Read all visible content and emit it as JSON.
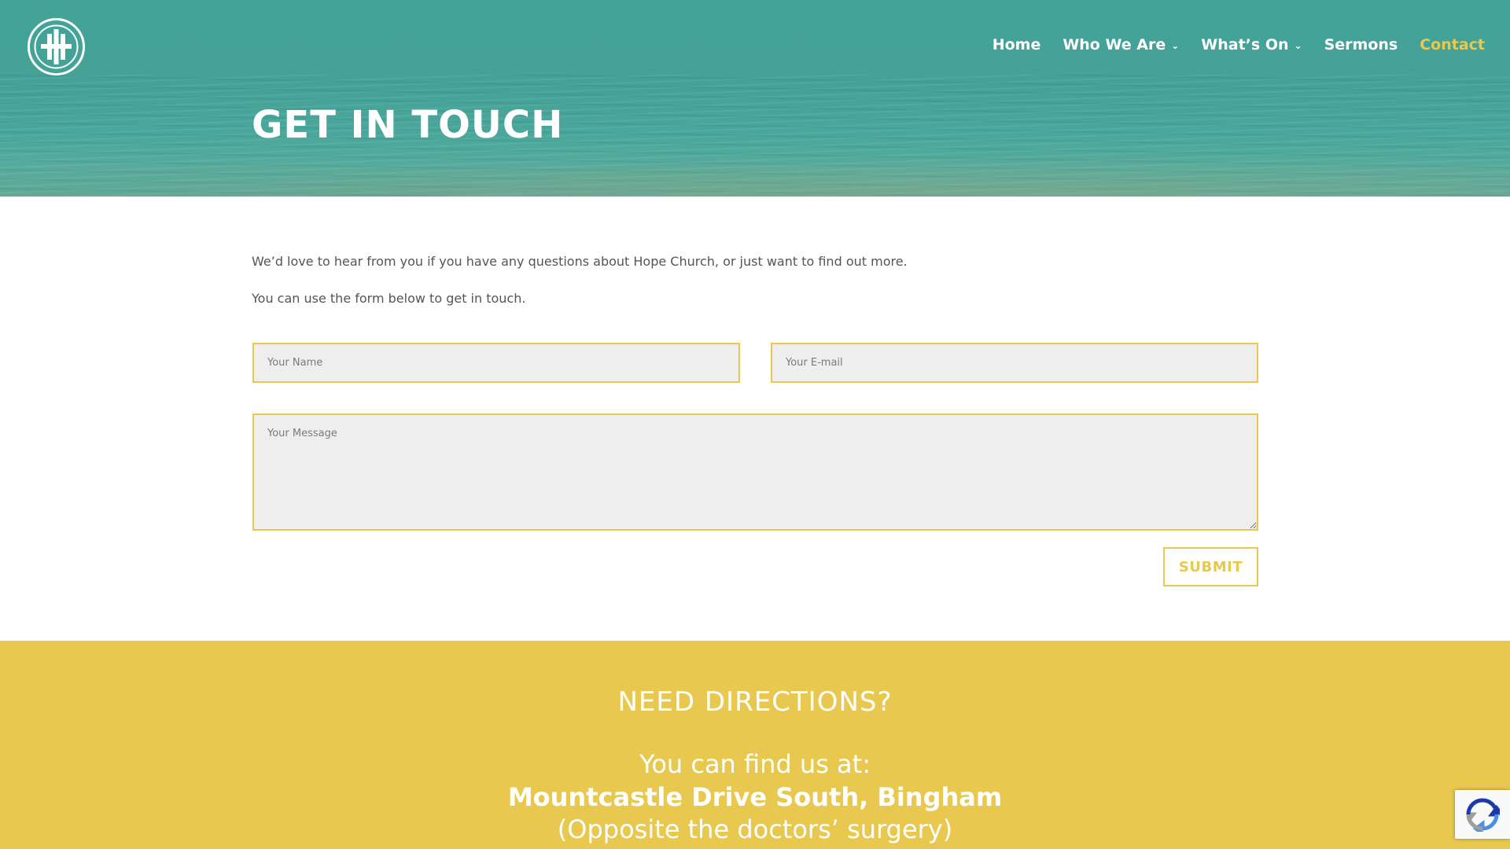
{
  "nav": {
    "items": [
      {
        "label": "Home",
        "has_dropdown": false,
        "active": false
      },
      {
        "label": "Who We Are",
        "has_dropdown": true,
        "active": false
      },
      {
        "label": "What’s On",
        "has_dropdown": true,
        "active": false
      },
      {
        "label": "Sermons",
        "has_dropdown": false,
        "active": false
      },
      {
        "label": "Contact",
        "has_dropdown": false,
        "active": true
      }
    ],
    "dropdown_icon": "chevron-down-icon"
  },
  "hero": {
    "title": "GET IN TOUCH"
  },
  "intro": {
    "line1": "We’d love to hear from you if you have any questions about Hope Church, or just want to find out more.",
    "line2": "You can use the form below to get in touch."
  },
  "form": {
    "name_placeholder": "Your Name",
    "name_value": "",
    "email_placeholder": "Your E-mail",
    "email_value": "",
    "message_placeholder": "Your Message",
    "message_value": "",
    "submit_label": "SUBMIT"
  },
  "directions": {
    "title": "NEED DIRECTIONS?",
    "line1": "You can find us at:",
    "line2": "Mountcastle Drive South, Bingham",
    "line3": "(Opposite the doctors’ surgery)"
  },
  "colors": {
    "teal": "#44a297",
    "accent_yellow": "#e8c84e",
    "text_gray": "#555555",
    "field_bg": "#eeeeee"
  },
  "icons": {
    "logo": "hope-church-logo",
    "recaptcha": "recaptcha-icon"
  }
}
